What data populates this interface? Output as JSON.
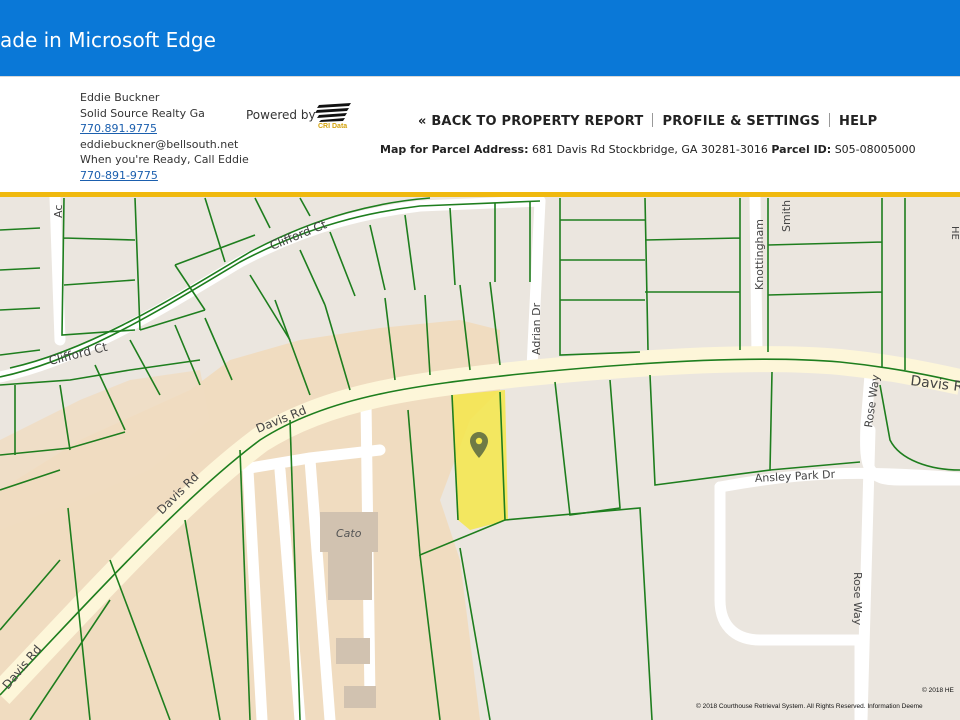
{
  "banner": {
    "text": "ade in Microsoft Edge"
  },
  "agent": {
    "name": "Eddie Buckner",
    "company": "Solid Source Realty Ga",
    "phone1": "770.891.9775",
    "email": "eddiebuckner@bellsouth.net",
    "tagline": "When you're Ready, Call Eddie",
    "phone2": "770-891-9775"
  },
  "powered_by": {
    "label": "Powered by",
    "logo_text": "CRI Data"
  },
  "nav": [
    {
      "label": "« BACK TO PROPERTY REPORT"
    },
    {
      "label": "PROFILE & SETTINGS"
    },
    {
      "label": "HELP"
    }
  ],
  "parcel": {
    "address_label": "Map for Parcel Address:",
    "address": "681 Davis Rd Stockbridge, GA 30281-3016",
    "id_label": "Parcel ID:",
    "id": "S05-08005000"
  },
  "map": {
    "labels": {
      "clifford_ct_1": "Clifford Ct",
      "clifford_ct_2": "Clifford Ct",
      "davis_rd_1": "Davis Rd",
      "davis_rd_2": "Davis Rd",
      "davis_rd_3": "Davis Rd",
      "davis_rd_4": "Davis R",
      "adrian_dr": "Adrian Dr",
      "knottingham": "Knottingham",
      "rose_way_1": "Rose Way",
      "rose_way_2": "Rose Way",
      "ansley_park_dr": "Ansley Park Dr",
      "cato": "Cato",
      "partial_label_top_left": "Ac",
      "partial_label_top_right": "Smith",
      "partial_label_edge": "HE"
    },
    "copyright_top": "© 2018 HE",
    "copyright": "© 2018 Courthouse Retrieval System. All Rights Reserved. Information Deeme",
    "colors": {
      "background": "#ebe6df",
      "commercial": "#f0dcc0",
      "road": "#ffffff",
      "main_road": "#fdf6d9",
      "parcel_line": "#1e7e1e",
      "highlight": "#f4e64a",
      "pin": "#6f7a45"
    }
  },
  "colors": {
    "banner": "#0a78d7",
    "accent": "#f0b90e",
    "link": "#1b5fae"
  }
}
